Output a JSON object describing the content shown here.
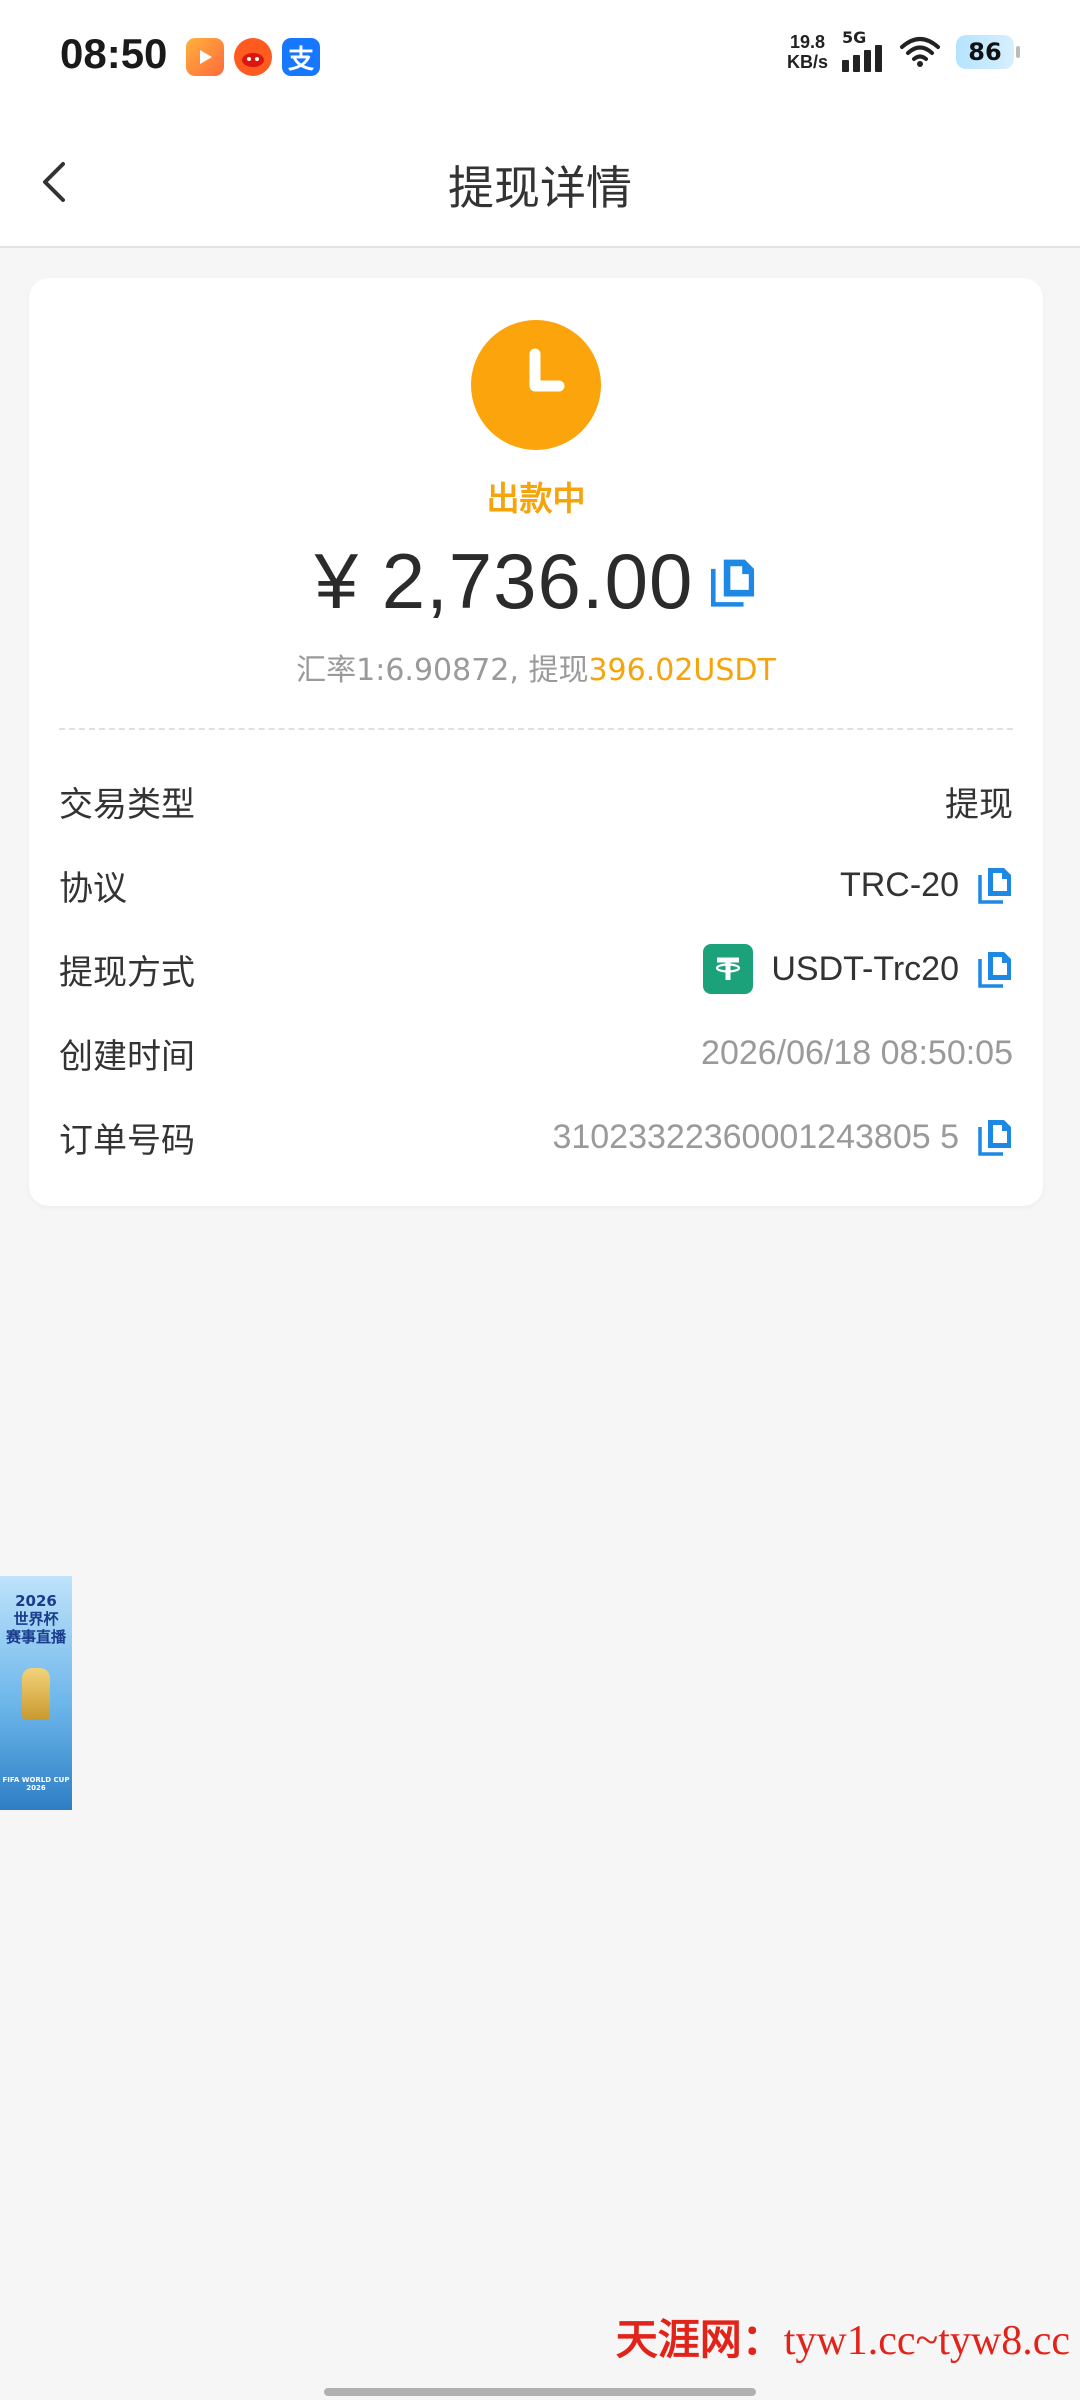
{
  "status_bar": {
    "time": "08:50",
    "net_speed_value": "19.8",
    "net_speed_unit": "KB/s",
    "network_type": "5G",
    "battery": "86",
    "app_icons": [
      "video-app-icon",
      "taobao-app-icon",
      "alipay-app-icon"
    ]
  },
  "nav": {
    "title": "提现详情",
    "back_icon": "chevron-left-icon"
  },
  "summary": {
    "status": "出款中",
    "amount": "¥ 2,736.00",
    "rate_prefix": "汇率1:6.90872, 提现",
    "rate_amount": "396.02USDT"
  },
  "details": [
    {
      "label": "交易类型",
      "value": "提现"
    },
    {
      "label": "协议",
      "value": "TRC-20"
    },
    {
      "label": "提现方式",
      "value": "USDT-Trc20"
    },
    {
      "label": "创建时间",
      "value": "2026/06/18 08:50:05"
    },
    {
      "label": "订单号码",
      "value": "31023322360001243805 5"
    }
  ],
  "banner": {
    "line1": "2026",
    "line2": "世界杯",
    "line3": "赛事直播",
    "footer": "FIFA WORLD CUP 2026"
  },
  "watermark": {
    "brand": "天涯网：",
    "urls": "tyw1.cc~tyw8.cc"
  },
  "colors": {
    "accent_orange": "#f5a40c",
    "copy_blue": "#1e88e5",
    "usdt_green": "#1ba27a",
    "watermark_red": "#e2231a"
  }
}
